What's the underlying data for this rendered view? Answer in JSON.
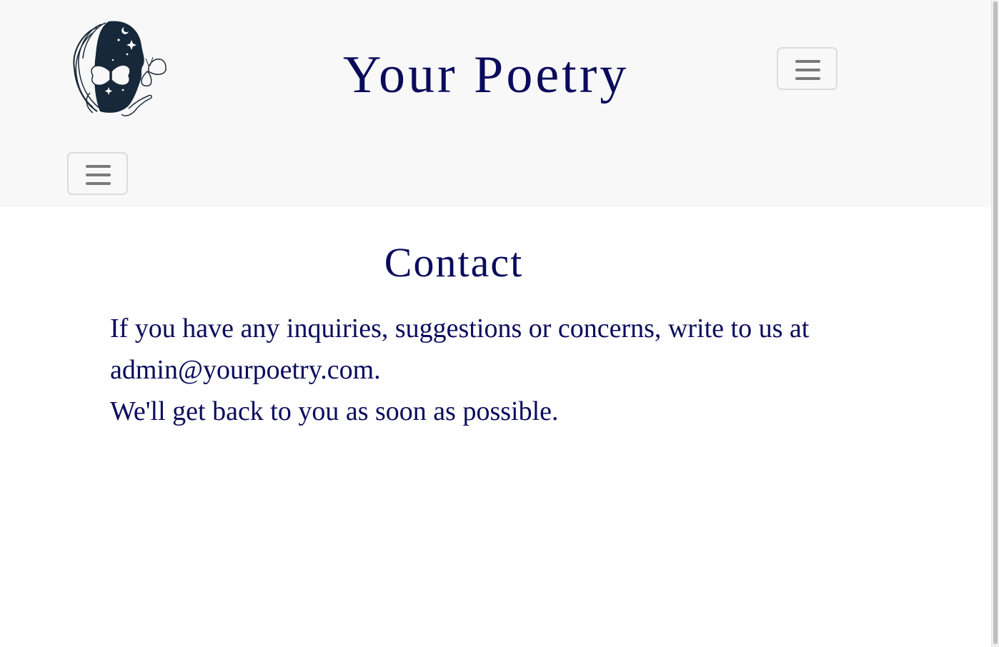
{
  "header": {
    "site_title": "Your Poetry",
    "logo_icon": "woman-with-butterflies-logo",
    "menu_icon": "hamburger-icon"
  },
  "contact": {
    "heading": "Contact",
    "line1": "If you have any inquiries, suggestions or concerns, write to us at admin@yourpoetry.com.",
    "line2": "We'll get back to you as soon as possible."
  },
  "colors": {
    "title_text": "#0b0b5c",
    "header_bg": "#f8f8f8",
    "toggler_border": "#dcdcdc",
    "icon_gray": "#7a7a7a"
  }
}
